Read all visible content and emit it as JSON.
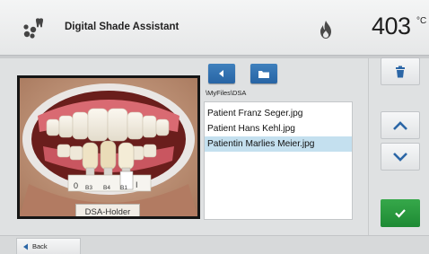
{
  "header": {
    "title": "Digital Shade Assistant",
    "temperature": "403",
    "temperature_unit": "°C",
    "app_icon": "dental-teeth-icon",
    "status_icon": "flame-icon"
  },
  "browser": {
    "path": "\\MyFiles\\DSA",
    "files": [
      "Patient Franz Seger.jpg",
      "Patient Hans Kehl.jpg",
      "Patientin Marlies Meier.jpg"
    ],
    "selected_index": 2
  },
  "preview": {
    "holder_label": "DSA-Holder",
    "tab_labels": [
      "0",
      "B3",
      "B4",
      "B1",
      "I"
    ]
  },
  "footer": {
    "back_label": "Back"
  },
  "colors": {
    "accent_blue": "#2764a4",
    "confirm_green": "#1e8a34",
    "selection": "#c4e0ef"
  }
}
